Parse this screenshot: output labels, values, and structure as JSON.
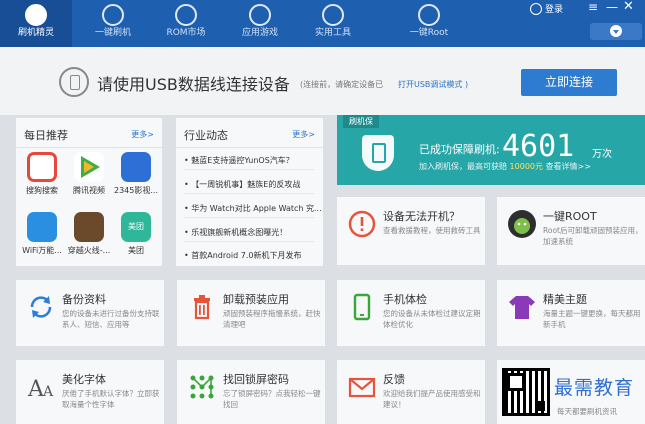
{
  "nav": {
    "items": [
      {
        "label": "刷机精灵",
        "icon": "shield-logo-icon"
      },
      {
        "label": "一键刷机",
        "icon": "cursor-icon"
      },
      {
        "label": "ROM市场",
        "icon": "rom-r-icon"
      },
      {
        "label": "应用游戏",
        "icon": "envelope-icon"
      },
      {
        "label": "实用工具",
        "icon": "grid-icon"
      },
      {
        "label": "一键Root",
        "icon": "android-icon"
      }
    ],
    "login_label": "登录",
    "menu_glyph": "≡",
    "min_glyph": "—",
    "close_glyph": "✕"
  },
  "connect": {
    "title": "请使用USB数据线连接设备",
    "hint": "(连接前，请确定设备已",
    "link": "打开USB调试模式 )",
    "button": "立即连接"
  },
  "daily": {
    "title": "每日推荐",
    "more": "更多>",
    "apps": [
      {
        "label": "搜狗搜索",
        "color": "#e8473c"
      },
      {
        "label": "腾讯视频",
        "color": "#3fae43"
      },
      {
        "label": "2345影视...",
        "color": "#2e6fd6"
      },
      {
        "label": "WiFi万能...",
        "color": "#2a8fe0"
      },
      {
        "label": "穿越火线-...",
        "color": "#6a4a2a"
      },
      {
        "label": "美团",
        "color": "#2fb79a"
      }
    ],
    "badge": "美团"
  },
  "industry": {
    "title": "行业动态",
    "more": "更多>",
    "news": [
      "• 魅蓝E支持遥控YunOS汽车？",
      "• 【一周锐机事】魅族E的反攻战",
      "• 华为 Watch对比 Apple Watch 究...",
      "• 乐视旗舰新机概念图曝光！",
      "• 首款Android 7.0新机下月发布"
    ]
  },
  "guard": {
    "tag": "刷机保",
    "line1": "已成功保障刷机:",
    "count": "4601",
    "unit": "万次",
    "line2_pre": "加入刷机保，最高可获赔 ",
    "line2_amount": "10000元",
    "line2_post": " 查看详情>>"
  },
  "tiles": [
    {
      "title": "设备无法开机？",
      "desc": "查看救援教程，使用救砖工具",
      "icon": "alert-circle-icon",
      "color": "#e8543a"
    },
    {
      "title": "一键ROOT",
      "desc": "Root后可卸载顽固预装应用，加速系统",
      "icon": "android-root-icon",
      "color": "#3a9a3a"
    },
    {
      "title": "备份资料",
      "desc": "您的设备未进行过备份支持联系人、短信、应用等",
      "icon": "sync-icon",
      "color": "#2a7ed6"
    },
    {
      "title": "卸载预装应用",
      "desc": "顽固预装程序拖慢系统，赶快清理吧",
      "icon": "trash-icon",
      "color": "#e8543a"
    },
    {
      "title": "手机体检",
      "desc": "您的设备从未体检过建议定期体检优化",
      "icon": "phone-check-icon",
      "color": "#3aa63a"
    },
    {
      "title": "精美主题",
      "desc": "海量主题一键更换，每天都用新手机",
      "icon": "shirt-icon",
      "color": "#8a3ab8"
    },
    {
      "title": "美化字体",
      "desc": "厌倦了手机默认字体？立即获取海量个性字体",
      "icon": "font-icon",
      "color": "#555555"
    },
    {
      "title": "找回锁屏密码",
      "desc": "忘了锁屏密码？点我轻松一键找回",
      "icon": "pattern-lock-icon",
      "color": "#3aa63a"
    },
    {
      "title": "反馈",
      "desc": "欢迎给我们提产品使用感受和建议！",
      "icon": "mail-icon",
      "color": "#e8543a"
    },
    {
      "title": "",
      "desc": "每天都要刷机资讯",
      "icon": "qr-code-icon",
      "color": "#333333"
    }
  ],
  "watermark": "最需教育"
}
